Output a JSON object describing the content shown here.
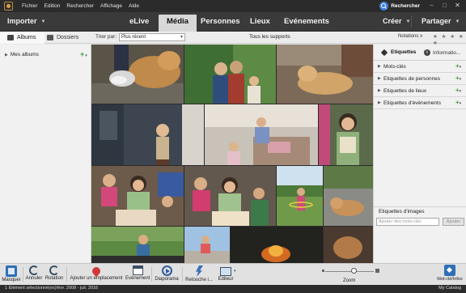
{
  "menubar": {
    "items": [
      "Fichier",
      "Edition",
      "Rechercher",
      "Affichage",
      "Aide"
    ],
    "search_label": "Rechercher"
  },
  "topnav": {
    "importer": "Importer",
    "tabs": [
      "eLive",
      "Média",
      "Personnes",
      "Lieux",
      "Evénements"
    ],
    "active_tab": "Média",
    "creer": "Créer",
    "partager": "Partager"
  },
  "subheader": {
    "albums": "Albums",
    "dossiers": "Dossiers",
    "sort_label": "Trier par:",
    "sort_value": "Plus récent",
    "tous_supports": "Tous les supports",
    "notations": "Notations",
    "rating_op": "≥",
    "stars": "★ ★ ★ ★ ★"
  },
  "leftpanel": {
    "mes_albums": "Mes albums"
  },
  "rightpanel": {
    "tab_etiquettes": "Etiquettes",
    "tab_informations": "Informatio...",
    "categories": [
      "Mots-clés",
      "Etiquettes de personnes",
      "Etiquettes de lieux",
      "Etiquettes d'événements"
    ],
    "image_tags_title": "Etiquettes d'images",
    "tag_input_placeholder": "Ajouter des mots-clés",
    "ajouter": "Ajouter"
  },
  "toolbar": {
    "masquer": "Masquer",
    "annuler": "Annuler",
    "rotation": "Rotation",
    "ajouter_emplacement": "Ajouter un emplacement",
    "evenement": "Evénement",
    "diaporama": "Diaporama",
    "retouche": "Retouche i...",
    "editeur": "Editeur",
    "zoom": "Zoom",
    "mots_cles_infos": "Mot-clé/Infos"
  },
  "statusbar": {
    "selection": "1 Elément sélectionné(es)",
    "dates": "févr. 2008 - juil. 2016",
    "catalog": "My Catalog"
  },
  "colors": {
    "menubar_bg": "#2b2b2b",
    "nav_bg": "#3a3a3a",
    "active_tab_bg": "#d8d8d8",
    "accent_green": "#3aa33a",
    "accent_blue": "#2f6fb7"
  }
}
